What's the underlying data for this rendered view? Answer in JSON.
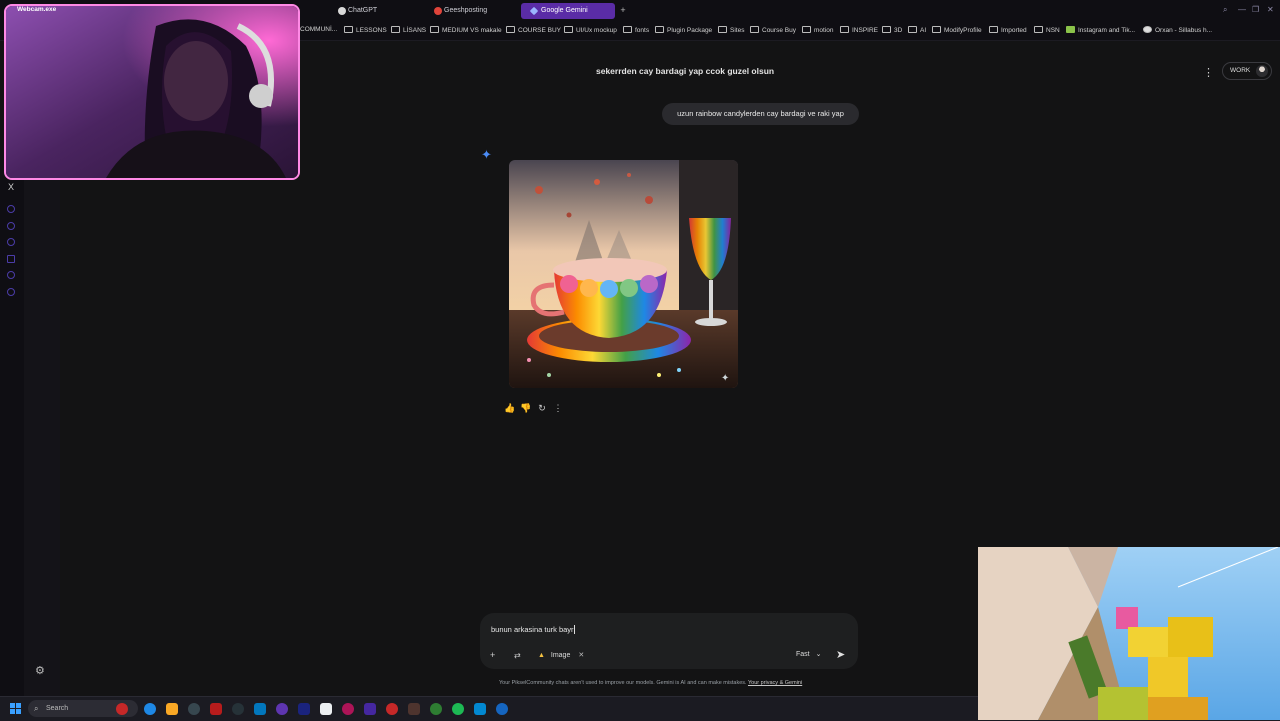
{
  "browser": {
    "tabs": [
      {
        "label": "ChatGPT",
        "active": false
      },
      {
        "label": "Geeshposting",
        "active": false
      },
      {
        "label": "Google Gemini",
        "active": true
      }
    ],
    "new_tab_glyph": "+"
  },
  "bookmarks": [
    "COMMUNİ...",
    "LESSONS",
    "LİSANS",
    "MEDIUM VS makale",
    "COURSE BUY",
    "UI/Ux mockup",
    "fonts",
    "Plugin Package",
    "Sites",
    "Course Buy",
    "motion",
    "INSPIRE",
    "3D",
    "AI",
    "ModifyProfile",
    "Imported",
    "NSN",
    "Instagram and Tik...",
    "Orxan - Sillabus h..."
  ],
  "overlay": {
    "webcam_label": "Webcam.exe"
  },
  "gemini": {
    "conversation_title": "sekerrden cay bardagi yap ccok guzel olsun",
    "workspace_chip": "WORK",
    "user_message": "uzun rainbow candylerden cay bardagi ve raki yap",
    "composer": {
      "text": "bunun arkasina turk bayr",
      "tool_chip": "Image",
      "model_label": "Fast"
    },
    "disclaimer": "Your PikselCommunity chats aren't used to improve our models. Gemini is AI and can make mistakes.",
    "disclaimer_link": "Your privacy & Gemini"
  },
  "taskbar": {
    "search_placeholder": "Search"
  },
  "colors": {
    "accent_tab": "#5a2ca6",
    "gemini_star": "#4b8bf5",
    "webcam_border": "#ff8ae6",
    "background": "#131314"
  }
}
